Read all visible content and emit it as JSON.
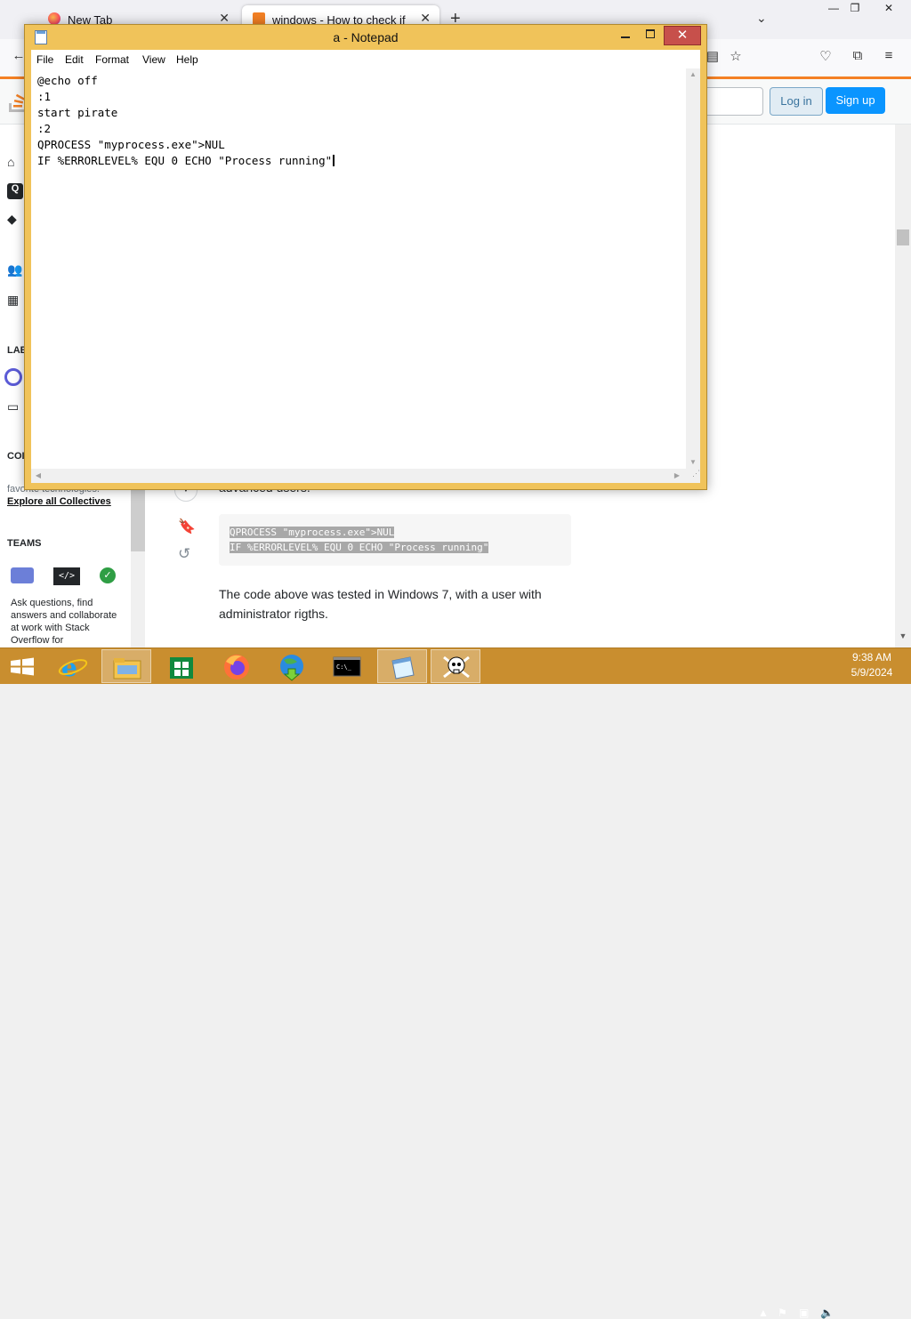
{
  "browser": {
    "tabs": [
      {
        "label": "New Tab",
        "close": "✕"
      },
      {
        "label": "windows - How to check if a process is running",
        "close": "✕"
      }
    ],
    "new_tab": "+",
    "tab_list": "⌄",
    "window_controls": {
      "minimize": "—",
      "maximize": "❐",
      "close": "✕"
    }
  },
  "stackoverflow": {
    "login_label": "Log in",
    "signup_label": "Sign up",
    "leftnav": {
      "labs_label": "LAE",
      "collectives_label": "COI",
      "collectives_desc": "favorite technologies.",
      "explore_label": "Explore all Collectives",
      "teams_label": "TEAMS",
      "teams_desc": "Ask questions, find answers and collaborate at work with Stack Overflow for"
    },
    "answer": {
      "preceding_text": "advanced users.",
      "code_lines": [
        "QPROCESS \"myprocess.exe\">NUL",
        "IF %ERRORLEVEL% EQU 0 ECHO \"Process running\""
      ],
      "paragraph": "The code above was tested in Windows 7, with a user with administrator rigths."
    }
  },
  "notepad": {
    "title": "a - Notepad",
    "close_label": "✕",
    "menu": [
      "File",
      "Edit",
      "Format",
      "View",
      "Help"
    ],
    "content": "@echo off\n:1\nstart pirate\n:2\nQPROCESS \"myprocess.exe\">NUL\nIF %ERRORLEVEL% EQU 0 ECHO \"Process running\""
  },
  "taskbar": {
    "apps": [
      "start",
      "internet-explorer",
      "file-explorer",
      "store",
      "firefox",
      "downloader",
      "command-prompt",
      "notepad",
      "pirate"
    ],
    "clock": {
      "time": "9:38 AM",
      "date": "5/9/2024"
    }
  },
  "colors": {
    "window_accent": "#f0c35a",
    "taskbar": "#c98e2f",
    "so_orange": "#f48024",
    "so_blue": "#0a95ff",
    "close_red": "#c7504b"
  }
}
